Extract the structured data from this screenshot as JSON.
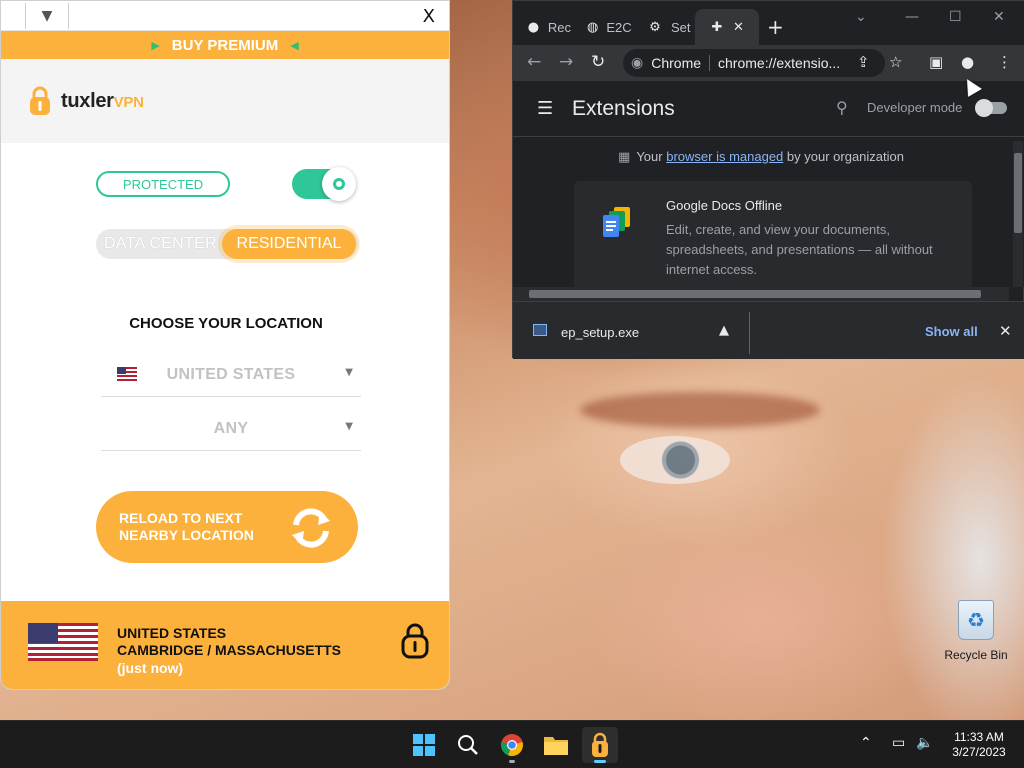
{
  "vpn": {
    "close_label": "X",
    "menu_icon": "chevron-down-icon",
    "buy_premium": "BUY PREMIUM",
    "logo_primary": "tuxler",
    "logo_secondary": "VPN",
    "status_label": "PROTECTED",
    "connection_on": true,
    "mode_options": [
      "DATA CENTER",
      "RESIDENTIAL"
    ],
    "mode_selected": "RESIDENTIAL",
    "choose_title": "CHOOSE YOUR LOCATION",
    "country_select": "UNITED STATES",
    "city_select": "ANY",
    "reload_line1": "RELOAD TO NEXT",
    "reload_line2": "NEARBY LOCATION",
    "footer_country": "UNITED STATES",
    "footer_city": "CAMBRIDGE / MASSACHUSETTS",
    "footer_time": "(just now)",
    "accent_color": "#fbb13c",
    "success_color": "#2fc79a"
  },
  "chrome": {
    "tabs": [
      {
        "label": "Rec",
        "icon": "github-icon"
      },
      {
        "label": "E2C",
        "icon": "globe-icon"
      },
      {
        "label": "Set",
        "icon": "gear-icon"
      },
      {
        "label": "",
        "icon": "puzzle-icon",
        "active": true
      }
    ],
    "omnibox_chip": "Chrome",
    "url": "chrome://extensio...",
    "page_title": "Extensions",
    "developer_mode_label": "Developer mode",
    "developer_mode_on": false,
    "managed_prefix": "Your",
    "managed_link": "browser is managed",
    "managed_suffix": "by your organization",
    "extension": {
      "name": "Google Docs Offline",
      "description": "Edit, create, and view your documents, spreadsheets, and presentations — all without internet access."
    },
    "download": {
      "filename": "ep_setup.exe",
      "show_all": "Show all"
    }
  },
  "desktop": {
    "recycle_bin_label": "Recycle Bin"
  },
  "taskbar": {
    "apps": [
      "windows-start-icon",
      "search-icon",
      "chrome-icon",
      "file-explorer-icon",
      "tuxler-vpn-icon"
    ],
    "time": "11:33 AM",
    "date": "3/27/2023"
  }
}
